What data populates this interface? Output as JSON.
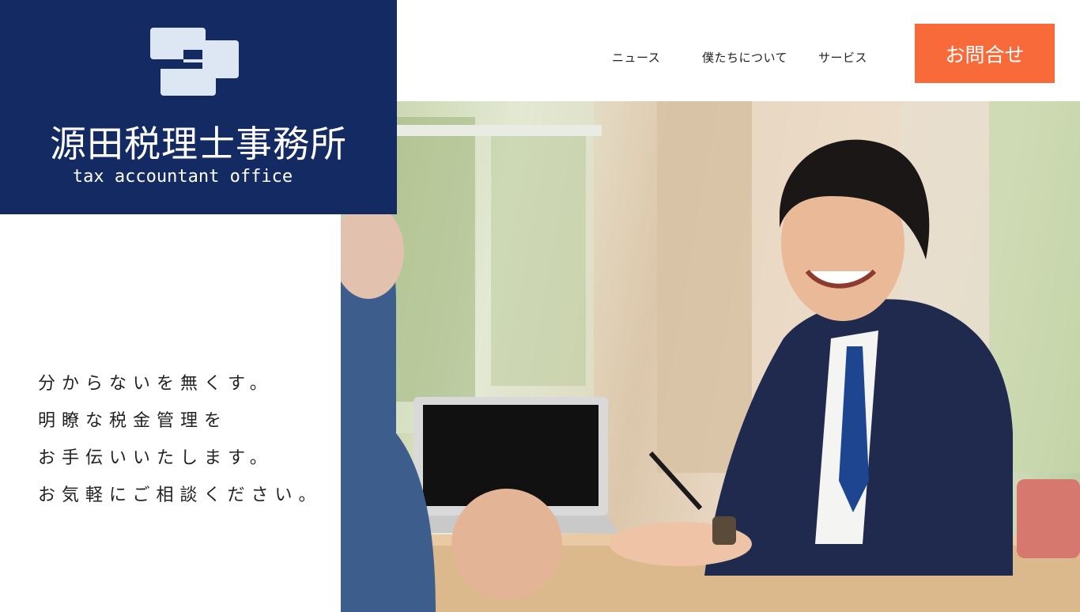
{
  "brand": {
    "name": "源田税理士事務所",
    "subtitle": "tax accountant office",
    "background": "#142a63"
  },
  "nav": {
    "items": [
      {
        "label": "ニュース"
      },
      {
        "label": "僕たちについて"
      },
      {
        "label": "サービス"
      }
    ],
    "contact_label": "お問合せ",
    "contact_color": "#f86a3a"
  },
  "tagline": {
    "lines": [
      "分からないを無くす。",
      "明瞭な税金管理を",
      "お手伝いいたします。",
      "お気軽にご相談ください。"
    ]
  },
  "hero": {
    "alt": "hero-photo-consultation"
  }
}
